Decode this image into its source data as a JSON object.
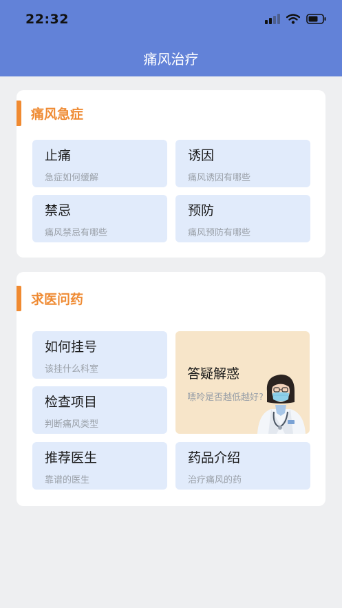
{
  "status_bar": {
    "time": "22:32"
  },
  "header": {
    "title": "痛风治疗"
  },
  "sections": [
    {
      "title": "痛风急症",
      "items": [
        {
          "title": "止痛",
          "subtitle": "急症如何缓解"
        },
        {
          "title": "诱因",
          "subtitle": "痛风诱因有哪些"
        },
        {
          "title": "禁忌",
          "subtitle": "痛风禁忌有哪些"
        },
        {
          "title": "预防",
          "subtitle": "痛风预防有哪些"
        }
      ]
    },
    {
      "title": "求医问药",
      "items": [
        {
          "title": "如何挂号",
          "subtitle": "该挂什么科室"
        },
        {
          "title": "检查项目",
          "subtitle": "判断痛风类型"
        },
        {
          "title": "推荐医生",
          "subtitle": "靠谱的医生"
        },
        {
          "title": "药品介绍",
          "subtitle": "治疗痛风的药"
        }
      ],
      "feature": {
        "title": "答疑解惑",
        "subtitle": "嘌呤是否越低越好?"
      }
    }
  ],
  "colors": {
    "header_bg": "#6282d8",
    "accent": "#f08a31",
    "tile_bg": "#e1ebfb",
    "feature_bg": "#f7e5c9",
    "page_bg": "#eeeff1"
  },
  "icons": [
    "signal-icon",
    "wifi-icon",
    "battery-icon",
    "doctor-illustration"
  ]
}
